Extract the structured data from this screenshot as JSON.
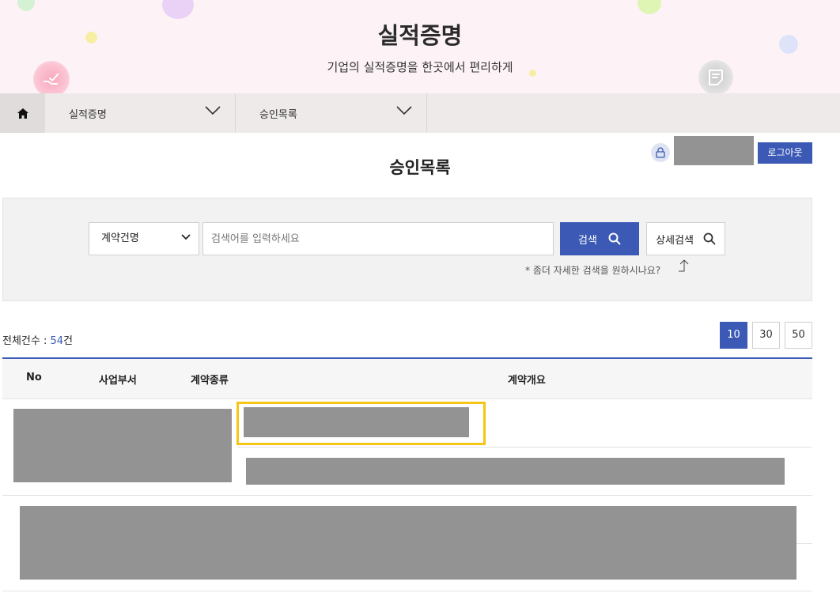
{
  "header": {
    "title": "실적증명",
    "subtitle": "기업의 실적증명을 한곳에서 편리하게"
  },
  "nav": {
    "items": [
      {
        "label": "실적증명"
      },
      {
        "label": "승인목록"
      }
    ]
  },
  "user": {
    "logout_label": "로그아웃"
  },
  "page": {
    "title": "승인목록"
  },
  "search": {
    "field_selected": "계약건명",
    "placeholder": "검색어를 입력하세요",
    "search_label": "검색",
    "advanced_label": "상세검색",
    "hint": "* 좀더 자세한 검색을 원하시나요?"
  },
  "list": {
    "count_prefix": "전체건수 : ",
    "count_value": "54",
    "count_suffix": "건",
    "page_sizes": [
      "10",
      "30",
      "50"
    ]
  },
  "table": {
    "columns": [
      "No",
      "사업부서",
      "계약종류",
      "계약개요"
    ]
  },
  "colors": {
    "accent": "#3b59b5",
    "highlight": "#f5c518",
    "redaction": "#939393"
  }
}
